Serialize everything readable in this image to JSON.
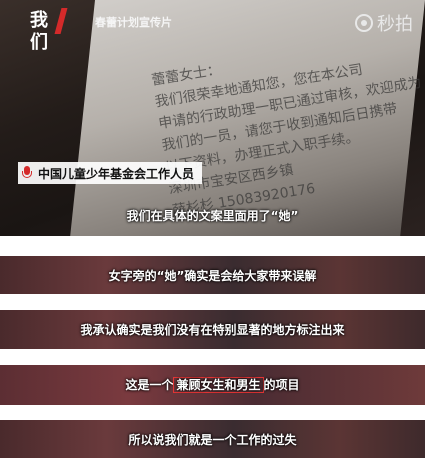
{
  "header": {
    "logo_text": "我们",
    "program_title": "春蕾计划宣传片",
    "brand_text": "秒拍"
  },
  "letter": {
    "lines": [
      "蕾蕾女士：",
      "我们很荣幸地通知您，您在本公司",
      "申请的行政助理一职已通过审核，欢迎成为",
      "我们的一员，请您于收到通知后日携带",
      "以下资料，办理正式入职手续。",
      "深圳市宝安区西乡镇",
      "薛杉杉 15083920176"
    ]
  },
  "speaker": {
    "label": "中国儿童少年基金会工作人员"
  },
  "subtitles": {
    "s1": "我们在具体的文案里面用了“她”",
    "s2": "女字旁的“她”确实是会给大家带来误解",
    "s3": "我承认确实是我们没有在特别显著的地方标注出来",
    "s4_pre": "这是一个",
    "s4_highlight": "兼顾女生和男生",
    "s4_post": "的项目",
    "s5": "所以说我们就是一个工作的过失"
  },
  "colors": {
    "accent_red": "#d42a2a",
    "highlight_box": "#e23535"
  }
}
